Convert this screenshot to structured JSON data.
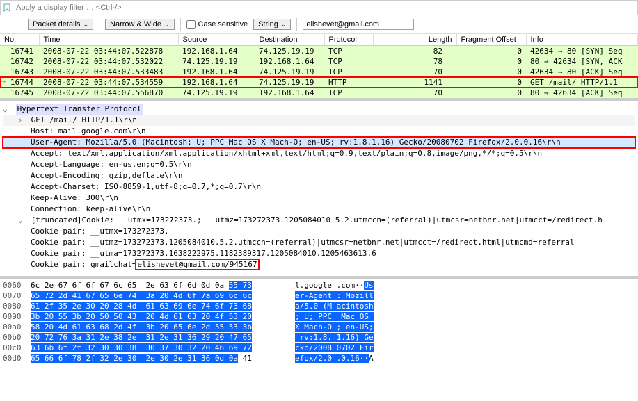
{
  "filter": {
    "placeholder": "Apply a display filter … <Ctrl-/>"
  },
  "toolbar": {
    "packet_details": "Packet details",
    "narrow_wide": "Narrow & Wide",
    "case_sensitive": "Case sensitive",
    "string": "String",
    "search_value": "elishevet@gmail.com"
  },
  "columns": {
    "no": "No.",
    "time": "Time",
    "source": "Source",
    "dest": "Destination",
    "proto": "Protocol",
    "len": "Length",
    "frag": "Fragment Offset",
    "info": "Info"
  },
  "rows": [
    {
      "no": "16741",
      "time": "2008-07-22 03:44:07.522878",
      "src": "192.168.1.64",
      "dst": "74.125.19.19",
      "proto": "TCP",
      "len": "82",
      "frag": "0",
      "info": "42634 → 80 [SYN] Seq"
    },
    {
      "no": "16742",
      "time": "2008-07-22 03:44:07.532022",
      "src": "74.125.19.19",
      "dst": "192.168.1.64",
      "proto": "TCP",
      "len": "78",
      "frag": "0",
      "info": "80 → 42634 [SYN, ACK"
    },
    {
      "no": "16743",
      "time": "2008-07-22 03:44:07.533483",
      "src": "192.168.1.64",
      "dst": "74.125.19.19",
      "proto": "TCP",
      "len": "70",
      "frag": "0",
      "info": "42634 → 80 [ACK] Seq"
    },
    {
      "no": "16744",
      "time": "2008-07-22 03:44:07.534559",
      "src": "192.168.1.64",
      "dst": "74.125.19.19",
      "proto": "HTTP",
      "len": "1141",
      "frag": "0",
      "info": "GET /mail/ HTTP/1.1"
    },
    {
      "no": "16745",
      "time": "2008-07-22 03:44:07.556870",
      "src": "74.125.19.19",
      "dst": "192.168.1.64",
      "proto": "TCP",
      "len": "70",
      "frag": "0",
      "info": "80 → 42634 [ACK] Seq"
    }
  ],
  "details": {
    "title": "Hypertext Transfer Protocol",
    "get": "GET /mail/ HTTP/1.1\\r\\n",
    "host": "Host: mail.google.com\\r\\n",
    "ua": "User-Agent: Mozilla/5.0 (Macintosh; U; PPC Mac OS X Mach-O; en-US; rv:1.8.1.16) Gecko/20080702 Firefox/2.0.0.16\\r\\n",
    "accept": "Accept: text/xml,application/xml,application/xhtml+xml,text/html;q=0.9,text/plain;q=0.8,image/png,*/*;q=0.5\\r\\n",
    "accept_lang": "Accept-Language: en-us,en;q=0.5\\r\\n",
    "accept_enc": "Accept-Encoding: gzip,deflate\\r\\n",
    "accept_chr": "Accept-Charset: ISO-8859-1,utf-8;q=0.7,*;q=0.7\\r\\n",
    "keepalive": "Keep-Alive: 300\\r\\n",
    "connection": "Connection: keep-alive\\r\\n",
    "cookie_trunc": "[truncated]Cookie: __utmx=173272373.; __utmz=173272373.1205084010.5.2.utmccn=(referral)|utmcsr=netbnr.net|utmcct=/redirect.h",
    "cookie1": "Cookie pair: __utmx=173272373.",
    "cookie2": "Cookie pair: __utmz=173272373.1205084010.5.2.utmccn=(referral)|utmcsr=netbnr.net|utmcct=/redirect.html|utmcmd=referral",
    "cookie3": "Cookie pair: __utma=173272373.1638222975.1182389317.1205084010.1205463613.6",
    "cookie4_prefix": "Cookie pair: gmailchat=",
    "cookie4_value": "elishevet@gmail.com/945167"
  },
  "hex": {
    "offsets": [
      "0060",
      "0070",
      "0080",
      "0090",
      "00a0",
      "00b0",
      "00c0",
      "00d0"
    ],
    "bytes": [
      {
        "pre": "6c 2e 67 6f 6f 67 6c 65  2e 63 6f 6d 0d 0a ",
        "sel": "55 73"
      },
      {
        "pre": "",
        "sel": "65 72 2d 41 67 65 6e 74  3a 20 4d 6f 7a 69 6c 6c"
      },
      {
        "pre": "",
        "sel": "61 2f 35 2e 30 20 28 4d  61 63 69 6e 74 6f 73 68"
      },
      {
        "pre": "",
        "sel": "3b 20 55 3b 20 50 50 43  20 4d 61 63 20 4f 53 20"
      },
      {
        "pre": "",
        "sel": "58 20 4d 61 63 68 2d 4f  3b 20 65 6e 2d 55 53 3b"
      },
      {
        "pre": "",
        "sel": "20 72 76 3a 31 2e 38 2e  31 2e 31 36 29 20 47 65"
      },
      {
        "pre": "",
        "sel": "63 6b 6f 2f 32 30 30 38  30 37 30 32 20 46 69 72"
      },
      {
        "pre": "",
        "sel": "65 66 6f 78 2f 32 2e 30  2e 30 2e 31 36 0d 0a",
        "post": " 41"
      }
    ],
    "ascii": [
      {
        "pre": "l.google .com··",
        "sel": "Us"
      },
      {
        "pre": "",
        "sel": "er-Agent : Mozill"
      },
      {
        "pre": "",
        "sel": "a/5.0 (M acintosh"
      },
      {
        "pre": "",
        "sel": "; U; PPC  Mac OS "
      },
      {
        "pre": "",
        "sel": "X Mach-O ; en-US;"
      },
      {
        "pre": "",
        "sel": " rv:1.8. 1.16) Ge"
      },
      {
        "pre": "",
        "sel": "cko/2008 0702 Fir"
      },
      {
        "pre": "",
        "sel": "efox/2.0 .0.16··",
        "post": "A"
      }
    ]
  }
}
